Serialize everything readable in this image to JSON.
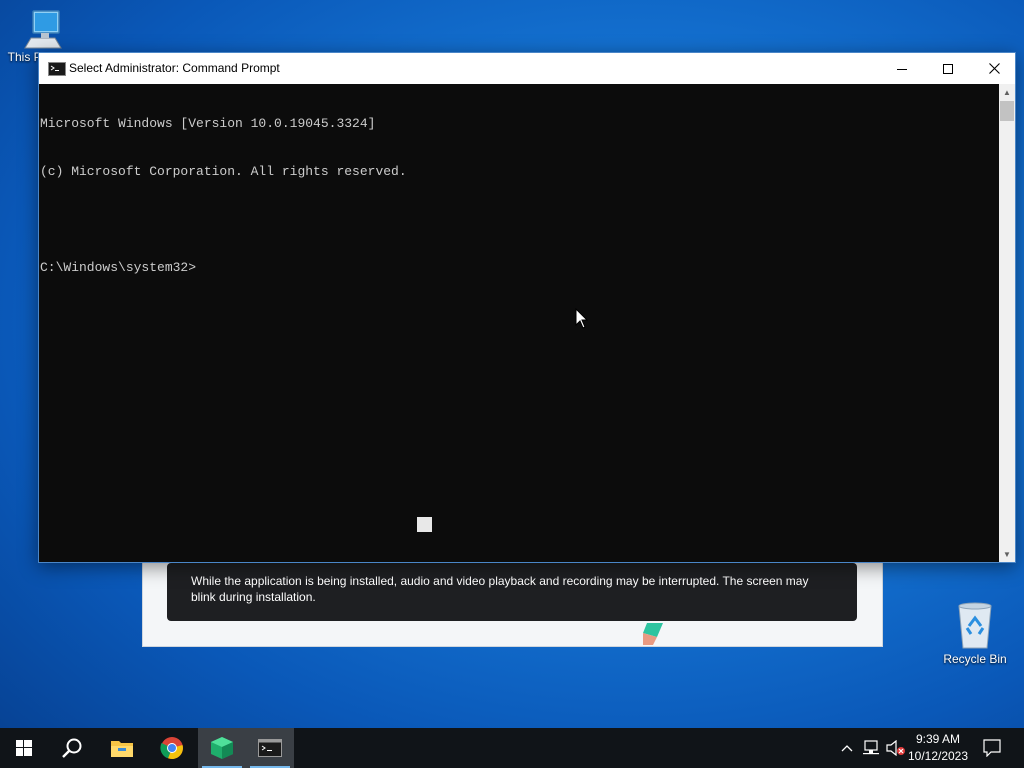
{
  "desktop": {
    "icons": [
      {
        "label": "This PC",
        "icon": "computer-icon"
      },
      {
        "label": "Recycle Bin",
        "icon": "recycle-bin-icon"
      }
    ]
  },
  "installer": {
    "notice": "While the application is being installed, audio and video playback and recording may be interrupted. The screen may blink during installation."
  },
  "cmd_window": {
    "title": "Select Administrator: Command Prompt",
    "lines": [
      "Microsoft Windows [Version 10.0.19045.3324]",
      "(c) Microsoft Corporation. All rights reserved.",
      "",
      "C:\\Windows\\system32>"
    ]
  },
  "taskbar": {
    "items": [
      "start-icon",
      "search-icon",
      "file-explorer-icon",
      "chrome-icon",
      "installer-app-icon",
      "command-prompt-icon"
    ],
    "active_item": "command-prompt-icon",
    "accent": "#76b9ed",
    "tray_icons": [
      "chevron-up-icon",
      "network-icon",
      "volume-muted-icon",
      "notification-icon"
    ],
    "time": "9:39 AM",
    "date": "10/12/2023"
  }
}
